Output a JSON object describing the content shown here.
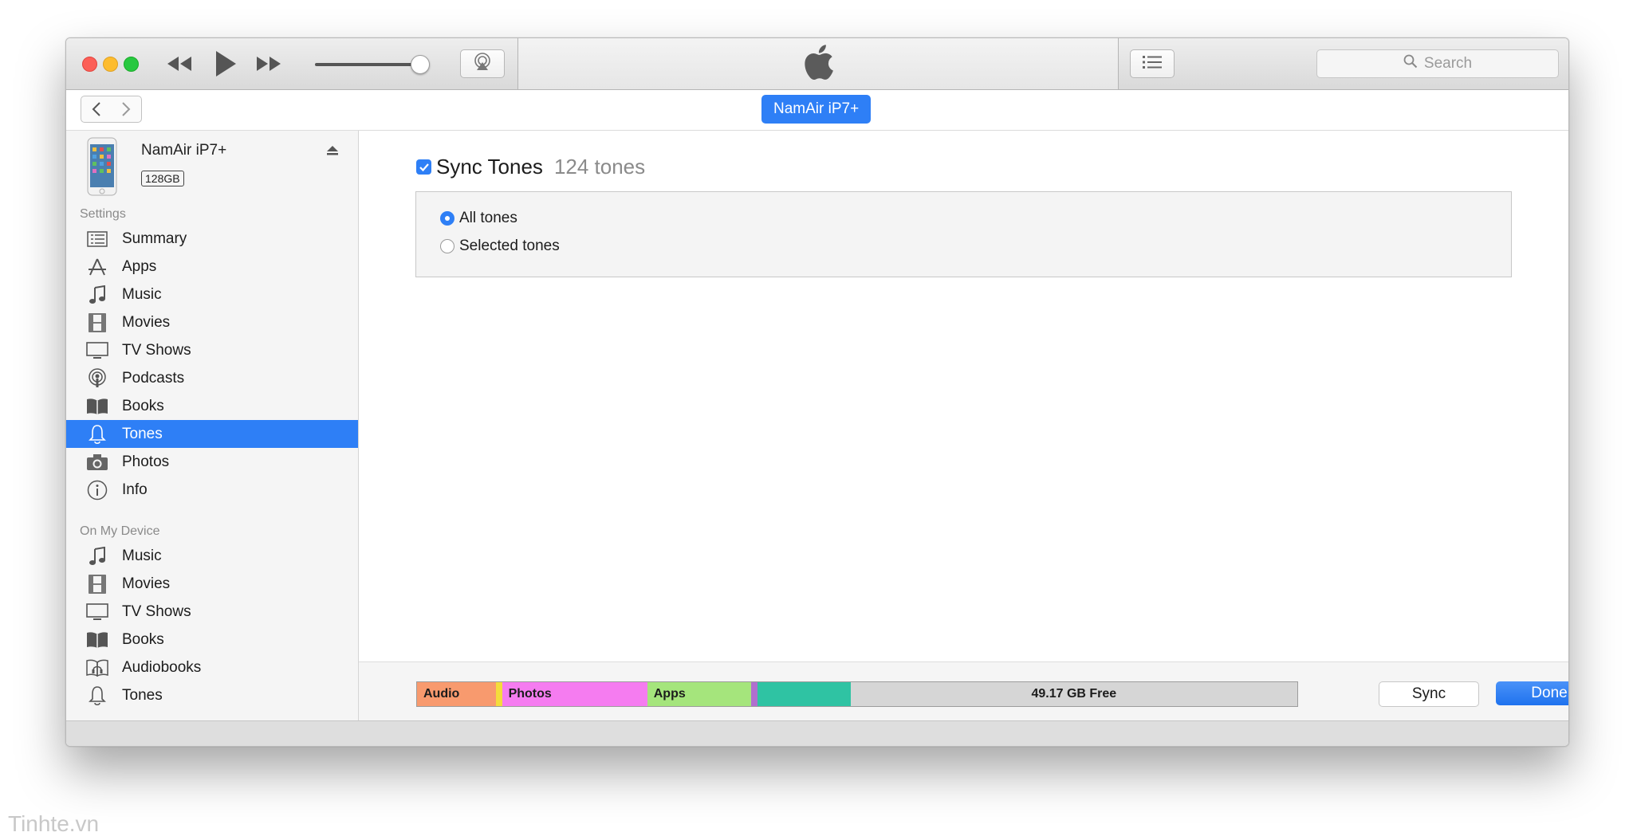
{
  "toolbar": {
    "icons": {
      "rewind": "rewind-icon",
      "play": "play-icon",
      "fast_forward": "fast-forward-icon",
      "airplay": "airplay-icon",
      "apple_logo": "apple-logo",
      "list": "list-icon",
      "search": "search-icon"
    },
    "volume_level": 0.9,
    "search_placeholder": "Search"
  },
  "navbar": {
    "device_pill": "NamAir iP7+"
  },
  "sidebar": {
    "device": {
      "name": "NamAir iP7+",
      "capacity": "128GB"
    },
    "settings_label": "Settings",
    "settings_items": [
      {
        "label": "Summary",
        "icon": "summary-icon"
      },
      {
        "label": "Apps",
        "icon": "apps-icon"
      },
      {
        "label": "Music",
        "icon": "music-note-icon"
      },
      {
        "label": "Movies",
        "icon": "film-icon"
      },
      {
        "label": "TV Shows",
        "icon": "tv-icon"
      },
      {
        "label": "Podcasts",
        "icon": "podcast-icon"
      },
      {
        "label": "Books",
        "icon": "book-icon"
      },
      {
        "label": "Tones",
        "icon": "bell-icon"
      },
      {
        "label": "Photos",
        "icon": "camera-icon"
      },
      {
        "label": "Info",
        "icon": "info-icon"
      }
    ],
    "selected": "Tones",
    "on_device_label": "On My Device",
    "device_items": [
      {
        "label": "Music",
        "icon": "music-note-icon"
      },
      {
        "label": "Movies",
        "icon": "film-icon"
      },
      {
        "label": "TV Shows",
        "icon": "tv-icon"
      },
      {
        "label": "Books",
        "icon": "book-icon"
      },
      {
        "label": "Audiobooks",
        "icon": "audiobook-icon"
      },
      {
        "label": "Tones",
        "icon": "bell-icon"
      }
    ]
  },
  "main": {
    "sync_checked": true,
    "sync_title": "Sync Tones",
    "sync_count": "124 tones",
    "options": [
      {
        "label": "All tones",
        "selected": true
      },
      {
        "label": "Selected tones",
        "selected": false
      }
    ]
  },
  "capacity_bar": {
    "segments": [
      {
        "label": "Audio",
        "color": "#f89a6e",
        "fraction": 0.09
      },
      {
        "label": "",
        "color": "#f4dc3c",
        "fraction": 0.004
      },
      {
        "label": "Photos",
        "color": "#f57cf0",
        "fraction": 0.166
      },
      {
        "label": "Apps",
        "color": "#a5e57c",
        "fraction": 0.119
      },
      {
        "label": "",
        "color": "#b06fcf",
        "fraction": 0.005
      },
      {
        "label": "",
        "color": "#2fc3a3",
        "fraction": 0.106
      },
      {
        "label": "49.17 GB Free",
        "color": "#d6d6d6",
        "fraction": 0.51
      }
    ]
  },
  "buttons": {
    "sync": "Sync",
    "done": "Done"
  },
  "watermark": "Tinhte.vn"
}
